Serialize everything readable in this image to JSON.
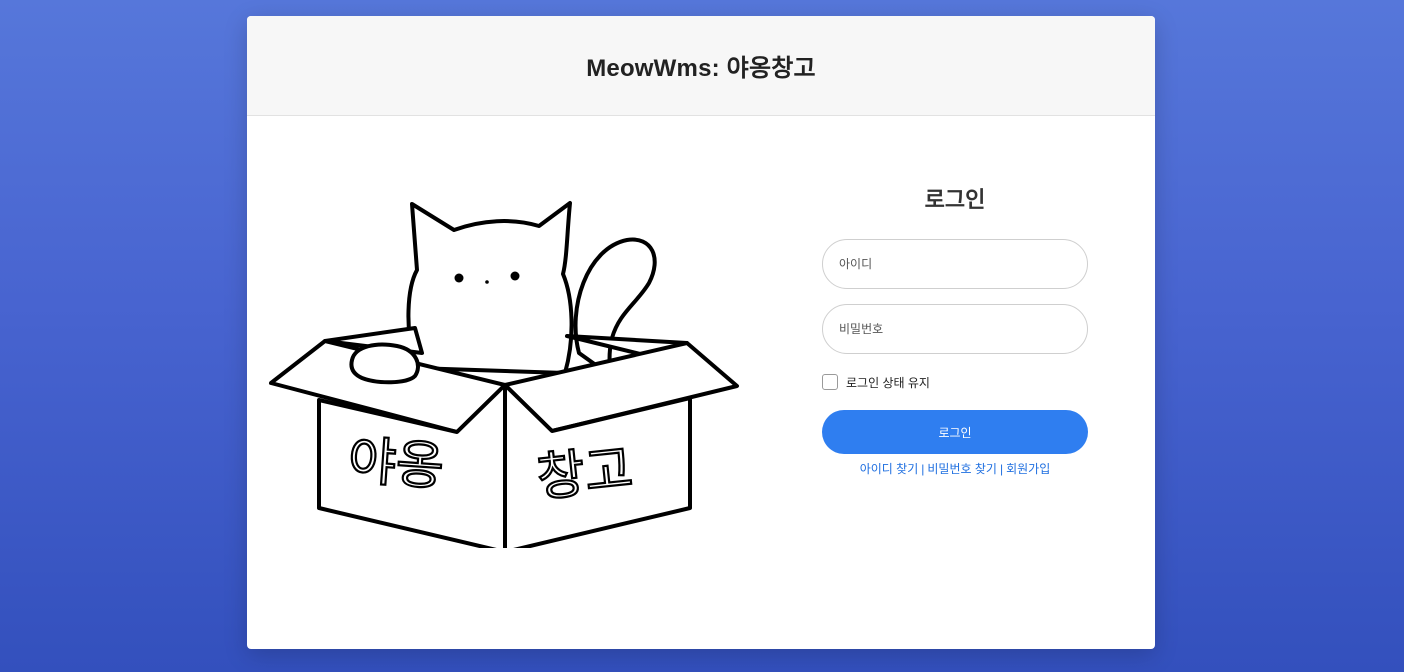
{
  "header": {
    "title": "MeowWms: 야옹창고"
  },
  "illustration": {
    "box_left_text": "야옹",
    "box_right_text": "창고"
  },
  "login": {
    "heading": "로그인",
    "id_placeholder": "아이디",
    "password_placeholder": "비밀번호",
    "remember_label": "로그인 상태 유지",
    "remember_checked": false,
    "submit_label": "로그인",
    "links": {
      "find_id": "아이디 찾기",
      "find_password": "비밀번호 찾기",
      "signup": "회원가입",
      "separator": "|"
    }
  },
  "colors": {
    "background_gradient_top": "#5677da",
    "background_gradient_bottom": "#3350bd",
    "primary_button": "#2f7ef0",
    "link": "#1f6fe0"
  }
}
